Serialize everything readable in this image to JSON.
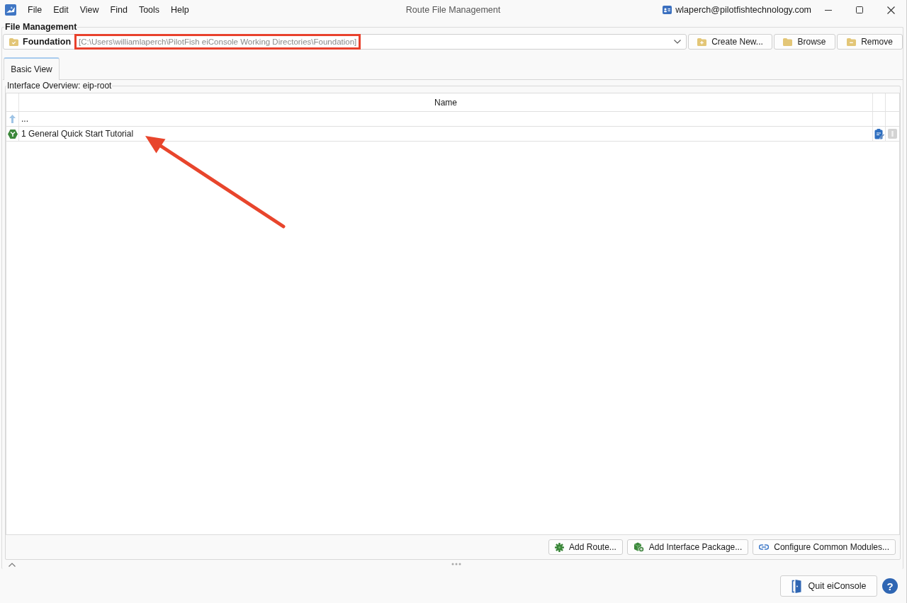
{
  "window": {
    "title": "Route File Management",
    "account": "wlaperch@pilotfishtechnology.com"
  },
  "menu": [
    "File",
    "Edit",
    "View",
    "Find",
    "Tools",
    "Help"
  ],
  "file_management": {
    "title": "File Management",
    "directory_label": "Foundation",
    "path_field": {
      "value": "[C:\\Users\\williamlaperch\\PilotFish eiConsole Working Directories\\Foundation]",
      "highlighted": true
    },
    "buttons": [
      {
        "label": "Create New...",
        "kind": "create"
      },
      {
        "label": "Browse",
        "kind": "browse"
      },
      {
        "label": "Remove",
        "kind": "remove"
      }
    ]
  },
  "tabs": [
    {
      "label": "Basic View",
      "selected": true
    }
  ],
  "overview": {
    "title": "Interface Overview: eip-root",
    "table": {
      "columns": [
        "Name"
      ],
      "rows": [
        {
          "kind": "parent",
          "name": "...",
          "pointed": false
        },
        {
          "kind": "route",
          "name": "1 General Quick Start Tutorial",
          "pointed": true
        }
      ]
    },
    "buttons": [
      {
        "label": "Add Route...",
        "kind": "route"
      },
      {
        "label": "Add Interface Package...",
        "kind": "package"
      },
      {
        "label": "Configure Common Modules...",
        "kind": "link"
      }
    ]
  },
  "footer": {
    "quit_button": "Quit eiConsole",
    "help_button": "?"
  }
}
